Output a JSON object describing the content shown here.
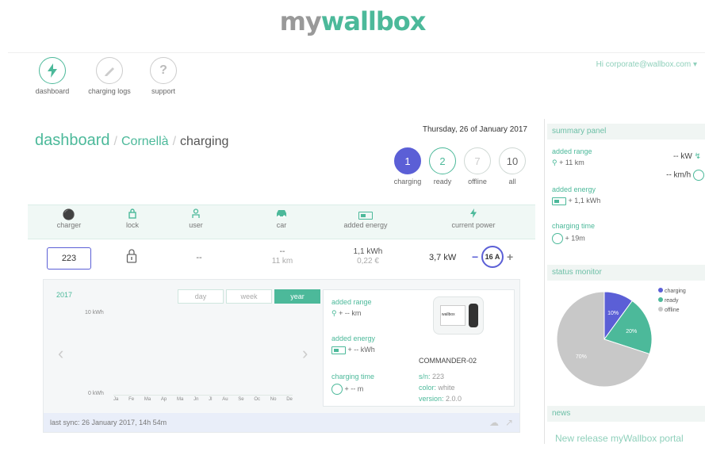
{
  "brand": {
    "my": "my",
    "wallbox": "wallbox"
  },
  "nav": [
    {
      "label": "dashboard",
      "icon": "bolt-icon",
      "active": true
    },
    {
      "label": "charging logs",
      "icon": "pencil-icon",
      "active": false
    },
    {
      "label": "support",
      "icon": "question-icon",
      "active": false
    }
  ],
  "user": {
    "greeting": "Hi corporate@wallbox.com ▾"
  },
  "breadcrumb": {
    "root": "dashboard",
    "location": "Cornellà",
    "current": "charging"
  },
  "date": "Thursday, 26 of January 2017",
  "status_counts": [
    {
      "count": "1",
      "label": "charging"
    },
    {
      "count": "2",
      "label": "ready"
    },
    {
      "count": "7",
      "label": "offline"
    },
    {
      "count": "10",
      "label": "all"
    }
  ],
  "table": {
    "headers": [
      "charger",
      "lock",
      "user",
      "car",
      "added energy",
      "current power"
    ],
    "row": {
      "charger": "223",
      "user": "--",
      "car_range": "--",
      "car_km": "11 km",
      "energy": "1,1 kWh",
      "cost": "0,22 €",
      "power": "3,7 kW",
      "current": "16 A",
      "minus": "−",
      "plus": "+"
    }
  },
  "detail": {
    "year": "2017",
    "tabs": [
      "day",
      "week",
      "year"
    ],
    "active_tab": "year",
    "y_top": "10 kWh",
    "y_bottom": "0 kWh",
    "months": [
      "Ja",
      "Fe",
      "Ma",
      "Ap",
      "Ma",
      "Jn",
      "Jl",
      "Au",
      "Se",
      "Oc",
      "No",
      "De"
    ],
    "prev": "‹",
    "next": "›",
    "added_range_label": "added range",
    "added_range_value": "+ -- km",
    "added_energy_label": "added energy",
    "added_energy_value": "+ -- kWh",
    "charging_time_label": "charging time",
    "charging_time_value": "+ -- m",
    "model": "COMMANDER-02",
    "device_brand": "wallbox",
    "sn_label": "s/n:",
    "sn": "223",
    "color_label": "color:",
    "color": "white",
    "version_label": "version:",
    "version": "2.0.0",
    "sync": "last sync: 26 January 2017, 14h 54m"
  },
  "summary": {
    "title": "summary panel",
    "added_range_label": "added range",
    "added_range_value": "+ 11 km",
    "power": "-- kW",
    "speed": "-- km/h",
    "added_energy_label": "added energy",
    "added_energy_value": "+ 1,1 kWh",
    "charging_time_label": "charging time",
    "charging_time_value": "+ 19m"
  },
  "status_monitor": {
    "title": "status monitor",
    "legend": [
      "charging",
      "ready",
      "offline"
    ],
    "colors": [
      "#5b5fd6",
      "#4cb99a",
      "#c8c8c8"
    ]
  },
  "chart_data": {
    "type": "pie",
    "categories": [
      "charging",
      "ready",
      "offline"
    ],
    "values": [
      10,
      20,
      70
    ],
    "labels": [
      "10%",
      "20%",
      "70%"
    ]
  },
  "news": {
    "title": "news",
    "headline": "New release myWallbox portal"
  }
}
